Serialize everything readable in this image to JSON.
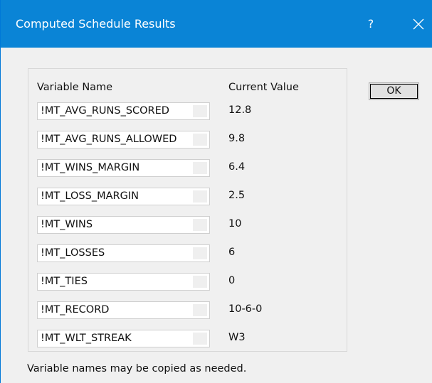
{
  "window": {
    "title": "Computed Schedule Results",
    "help_label": "?",
    "accent_color": "#0a84d6"
  },
  "table": {
    "header_name": "Variable Name",
    "header_value": "Current Value",
    "rows": [
      {
        "name": "!MT_AVG_RUNS_SCORED",
        "value": "12.8"
      },
      {
        "name": "!MT_AVG_RUNS_ALLOWED",
        "value": "9.8"
      },
      {
        "name": "!MT_WINS_MARGIN",
        "value": "6.4"
      },
      {
        "name": "!MT_LOSS_MARGIN",
        "value": "2.5"
      },
      {
        "name": "!MT_WINS",
        "value": "10"
      },
      {
        "name": "!MT_LOSSES",
        "value": "6"
      },
      {
        "name": "!MT_TIES",
        "value": "0"
      },
      {
        "name": "!MT_RECORD",
        "value": "10-6-0"
      },
      {
        "name": "!MT_WLT_STREAK",
        "value": "W3"
      }
    ]
  },
  "buttons": {
    "ok_label": "OK"
  },
  "footer": {
    "note": "Variable names may be copied as needed."
  }
}
